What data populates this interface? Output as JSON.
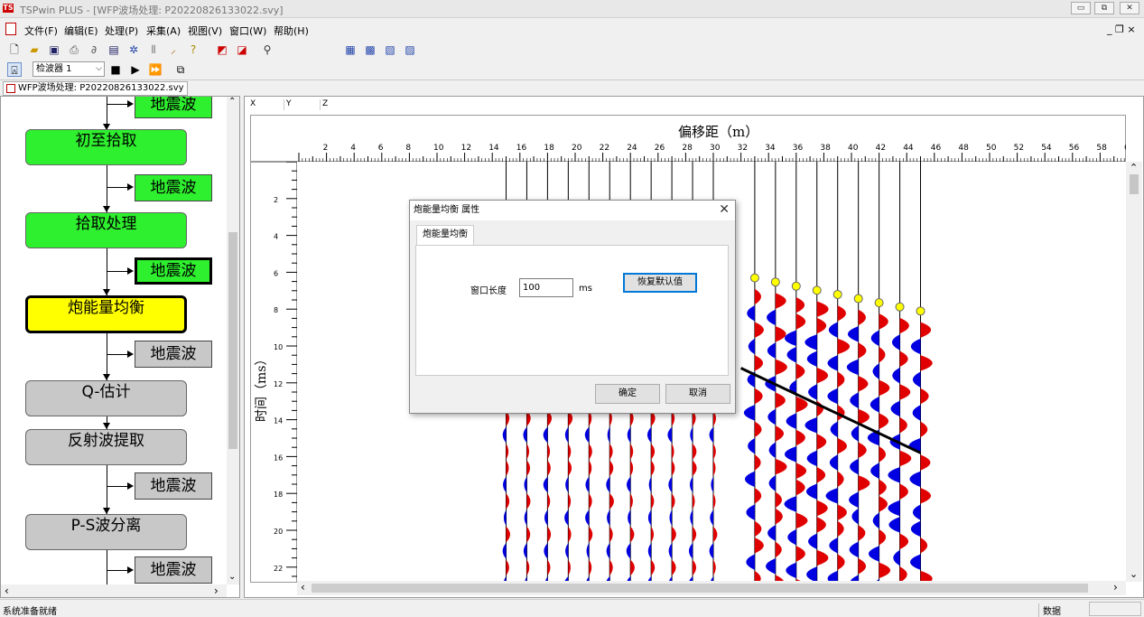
{
  "window": {
    "app_title": "TSPwin PLUS - [WFP波场处理: P20220826133022.svy]",
    "logo_text": "TS",
    "minimize": "▭",
    "restore": "⧉",
    "close": "✕"
  },
  "menu": [
    "文件(F)",
    "编辑(E)",
    "处理(P)",
    "采集(A)",
    "视图(V)",
    "窗口(W)",
    "帮助(H)"
  ],
  "mdi_controls": "_ ❐ ×",
  "toolbar2": {
    "combo_value": "检波器 1",
    "combo_arrow": "⌵"
  },
  "doc_tab": "WFP波场处理: P20220826133022.svy",
  "flow": {
    "waves": "地震波",
    "nodes": [
      "初至拾取",
      "拾取处理",
      "炮能量均衡",
      "Q-估计",
      "反射波提取",
      "P-S波分离"
    ]
  },
  "seismic": {
    "coord_labels": [
      "X",
      "Y",
      "Z"
    ],
    "x_axis_title": "偏移距（m）",
    "y_axis_title": "时间（ms）",
    "x_ticks": [
      "2",
      "4",
      "6",
      "8",
      "10",
      "12",
      "14",
      "16",
      "18",
      "20",
      "22",
      "24",
      "26",
      "28",
      "30",
      "32",
      "34",
      "36",
      "38",
      "40",
      "42",
      "44",
      "46",
      "48",
      "50",
      "52",
      "54",
      "56",
      "58",
      "60"
    ],
    "y_ticks": [
      "2",
      "4",
      "6",
      "8",
      "10",
      "12",
      "14",
      "16",
      "18",
      "20",
      "22"
    ],
    "scroll_up": "⌃",
    "scroll_down": "⌄",
    "scroll_left": "‹",
    "scroll_right": "›"
  },
  "dialog": {
    "title": "炮能量均衡 属性",
    "close": "✕",
    "tab": "炮能量均衡",
    "window_label": "窗口长度",
    "window_value": "100",
    "unit": "ms",
    "restore_defaults": "恢复默认值",
    "ok": "确定",
    "cancel": "取消"
  },
  "status": {
    "ready": "系统准备就绪",
    "data": "数据"
  },
  "colors": {
    "positive_lobe": "#e00000",
    "negative_lobe": "#0000e0",
    "pick_marker": "#ffff00",
    "node_active": "#2ef02e",
    "node_current": "#ffff00",
    "node_inactive": "#c8c8c8"
  }
}
